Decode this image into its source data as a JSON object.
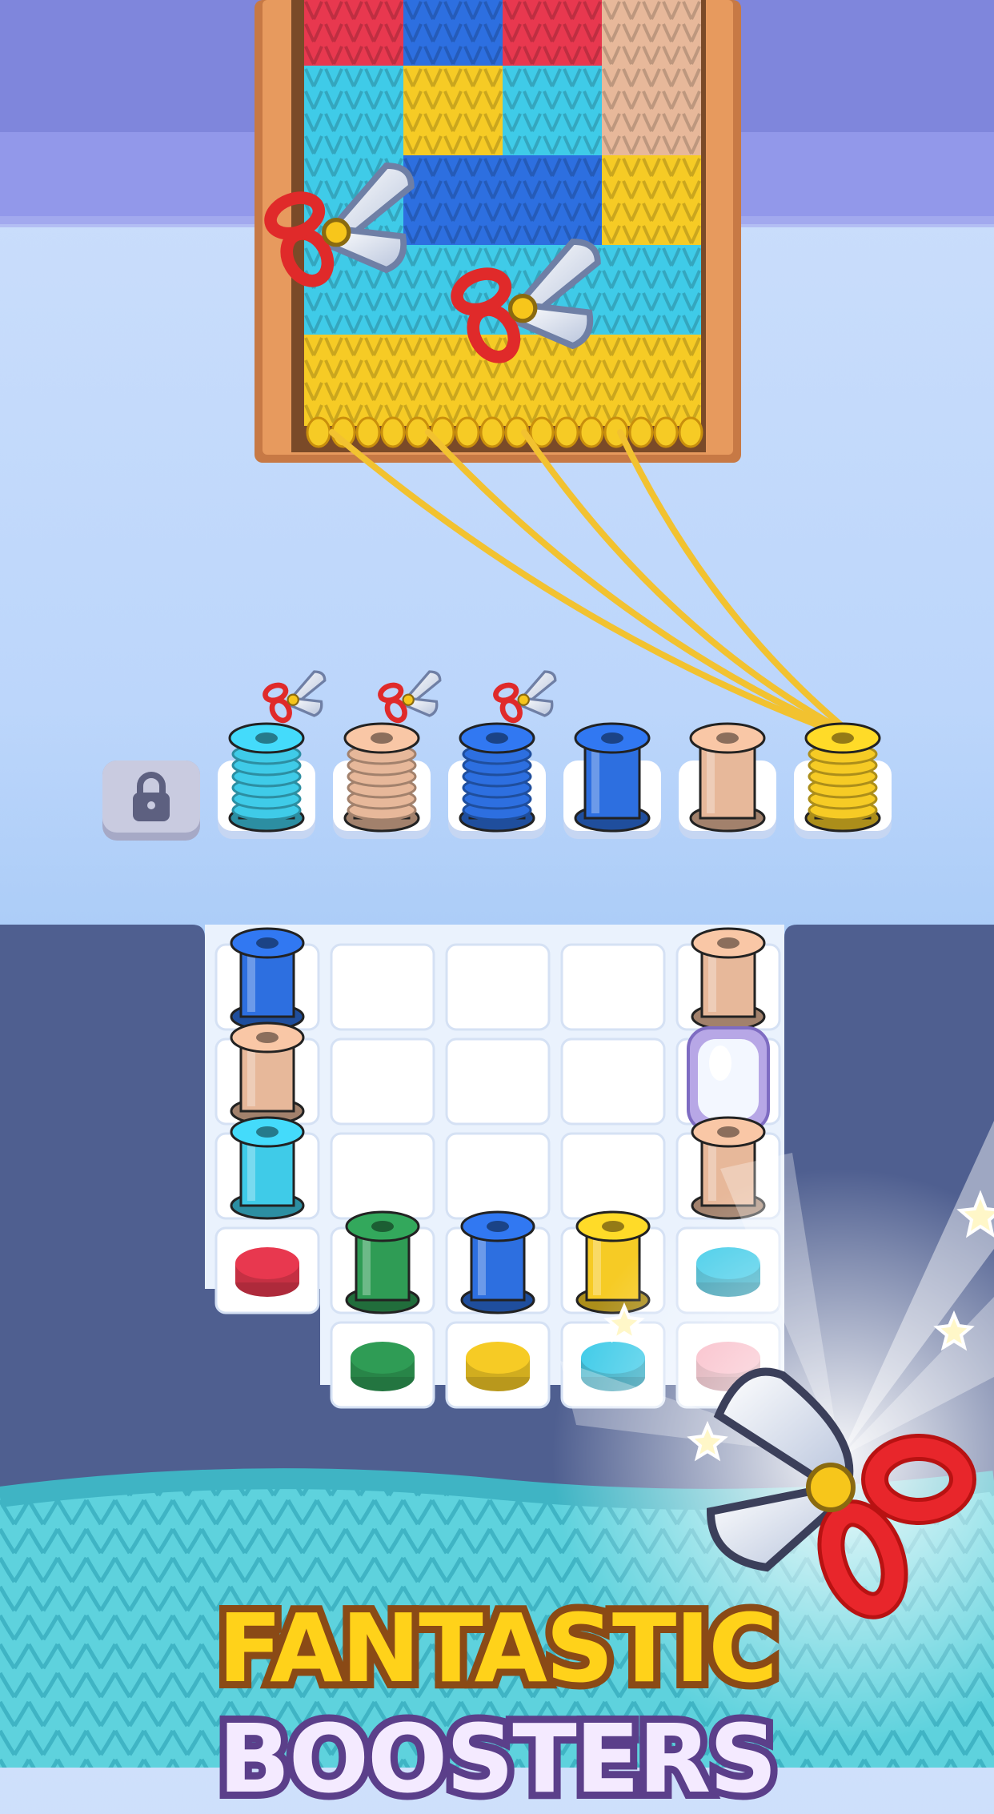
{
  "banner": {
    "word1": "FANTASTIC",
    "word2": "BOOSTERS"
  },
  "colors": {
    "red": "#e8384f",
    "blue": "#2d6fe0",
    "cyan": "#3fcbe8",
    "tan": "#e7b89a",
    "yellow": "#f6cb25",
    "green": "#2f9c55",
    "pink": "#f7a9b8",
    "board_dark": "#4f5f90",
    "knit_bottom": "#5ed2dd"
  },
  "knit_panel": {
    "columns": [
      [
        "red",
        "cyan",
        "cyan",
        "cyan",
        "yellow"
      ],
      [
        "blue",
        "yellow",
        "blue",
        "cyan",
        "yellow"
      ],
      [
        "red",
        "cyan",
        "blue",
        "cyan",
        "yellow"
      ],
      [
        "tan",
        "tan",
        "yellow",
        "cyan",
        "yellow"
      ]
    ]
  },
  "queue_slots": [
    {
      "state": "locked",
      "icon": "padlock-icon"
    },
    {
      "spool": "cyan",
      "booster": true
    },
    {
      "spool": "tan",
      "booster": true
    },
    {
      "spool": "blue",
      "booster": true
    },
    {
      "spool": "blue",
      "booster": false
    },
    {
      "spool": "tan",
      "booster": false
    },
    {
      "spool": "yellow",
      "booster": false,
      "wound": true
    }
  ],
  "grid": {
    "rows": [
      [
        "blue-spool",
        "",
        "",
        "",
        "tan-spool"
      ],
      [
        "tan-spool",
        "",
        "",
        "",
        "glass-box"
      ],
      [
        "cyan-spool",
        "",
        "",
        "",
        "tan-spool"
      ],
      [
        "red-cap",
        "green-spool",
        "blue-spool",
        "yellow-spool",
        "cyan-cap"
      ],
      [
        "none",
        "green-cap",
        "yellow-cap",
        "cyan-cap",
        "pink-cap"
      ]
    ]
  }
}
